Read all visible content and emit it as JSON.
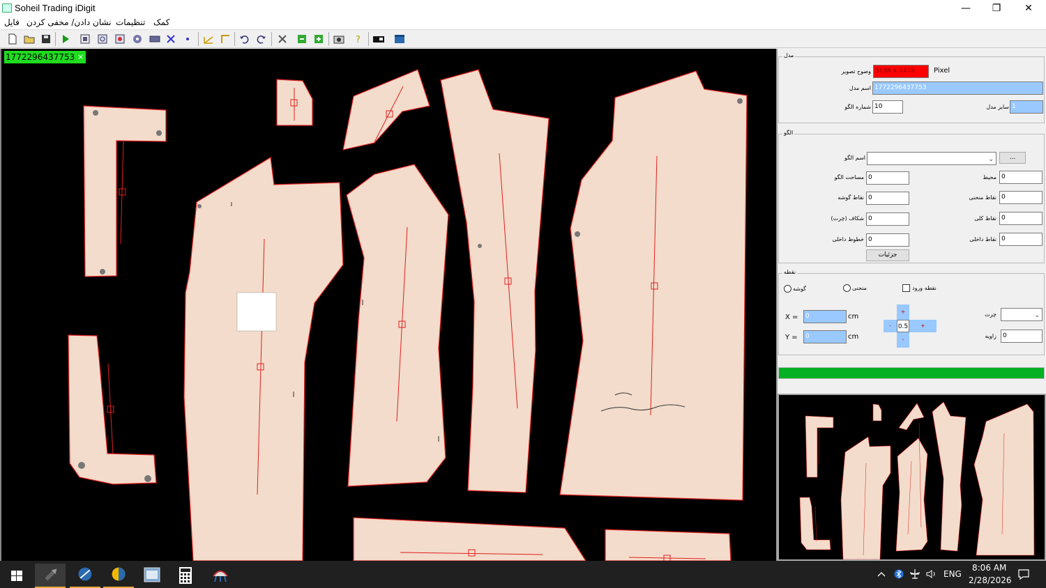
{
  "window": {
    "title": "Soheil Trading iDigit",
    "minimize_glyph": "—",
    "maximize_glyph": "❐",
    "close_glyph": "✕"
  },
  "menu": {
    "items": [
      "کمک",
      "تنظیمات",
      "نشان دادن/ مخفی کردن",
      "فایل"
    ]
  },
  "toolbar": {
    "icons": [
      "new-file-icon",
      "open-folder-icon",
      "save-icon",
      "play-icon",
      "fit-icon",
      "zoom-icon",
      "select-icon",
      "record-icon",
      "rectangle-icon",
      "cross-icon",
      "point-icon",
      "measure-icon",
      "corner-icon",
      "undo-icon",
      "redo-icon",
      "tools-icon",
      "export-icon",
      "import-icon",
      "camera-icon",
      "help-icon",
      "display-icon",
      "window-icon"
    ]
  },
  "canvas": {
    "file_tab_label": "1772296437753",
    "file_tab_close": "×"
  },
  "panel": {
    "model_group": {
      "title": "مدل",
      "image_resolution_label": "وضوح تصویر",
      "image_resolution_value": "3186 x 2478",
      "resolution_unit": "Pixel",
      "model_name_label": "اسم مدل",
      "model_name_value": "1772296437753",
      "pattern_number_label": "شماره الگو",
      "pattern_number_value": "10",
      "model_size_label": "سایز مدل",
      "model_size_value": "1"
    },
    "pattern_group": {
      "title": "الگو",
      "pattern_name_label": "اسم الگو",
      "pattern_name_value": "",
      "browse_label": "...",
      "area_label": "مساحت الگو",
      "area_value": "0",
      "perimeter_label": "محیط",
      "perimeter_value": "0",
      "corner_points_label": "نقاط گوشه",
      "corner_points_value": "0",
      "curve_points_label": "نقاط منحنی",
      "curve_points_value": "0",
      "notch_label": "شکاف (چرت)",
      "notch_value": "0",
      "total_points_label": "نقاط کلی",
      "total_points_value": "0",
      "inner_lines_label": "خطوط داخلی",
      "inner_lines_value": "0",
      "inner_points_label": "نقاط داخلی",
      "inner_points_value": "0",
      "details_button": "جزئیات"
    },
    "point_group": {
      "title": "نقطه",
      "corner_radio": "گوشه",
      "curve_radio": "منحنی",
      "entry_point_check": "نقطه ورود",
      "x_label": "X =",
      "x_value": "0",
      "x_unit": "cm",
      "y_label": "Y =",
      "y_value": "0",
      "y_unit": "cm",
      "step_value": "0.5",
      "pad_up": "+",
      "pad_down": "-",
      "pad_left": "-",
      "pad_right": "+",
      "notch_label": "چرت",
      "notch_value": "",
      "angle_label": "زاویه",
      "angle_value": "0"
    },
    "progress": 1.0,
    "progress_color": "#06b025"
  },
  "taskbar": {
    "apps": [
      "start-icon",
      "app-cursor-icon",
      "app-scissors-icon",
      "app-chart-icon",
      "app-cad-icon",
      "calculator-icon",
      "app-pattern-icon"
    ],
    "language": "ENG",
    "time": "8:06 AM",
    "date": "2/28/2026"
  }
}
